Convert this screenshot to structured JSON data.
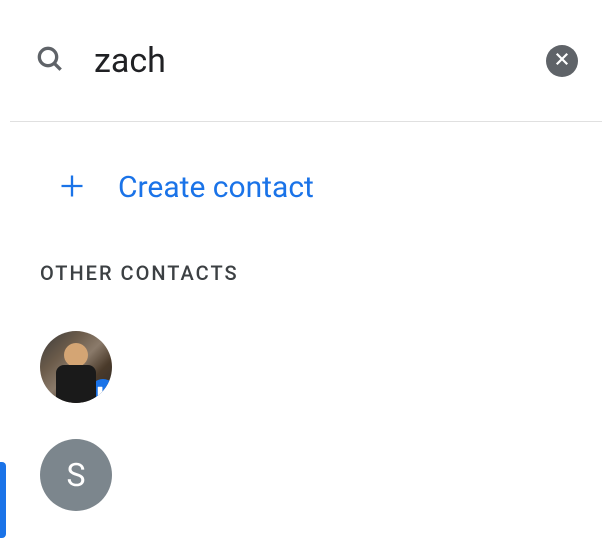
{
  "search": {
    "value": "zach",
    "placeholder": ""
  },
  "create_contact_label": "Create contact",
  "section_header": "Other Contacts",
  "contacts": [
    {
      "type": "photo",
      "has_org_badge": true
    },
    {
      "type": "letter",
      "initial": "S"
    }
  ]
}
